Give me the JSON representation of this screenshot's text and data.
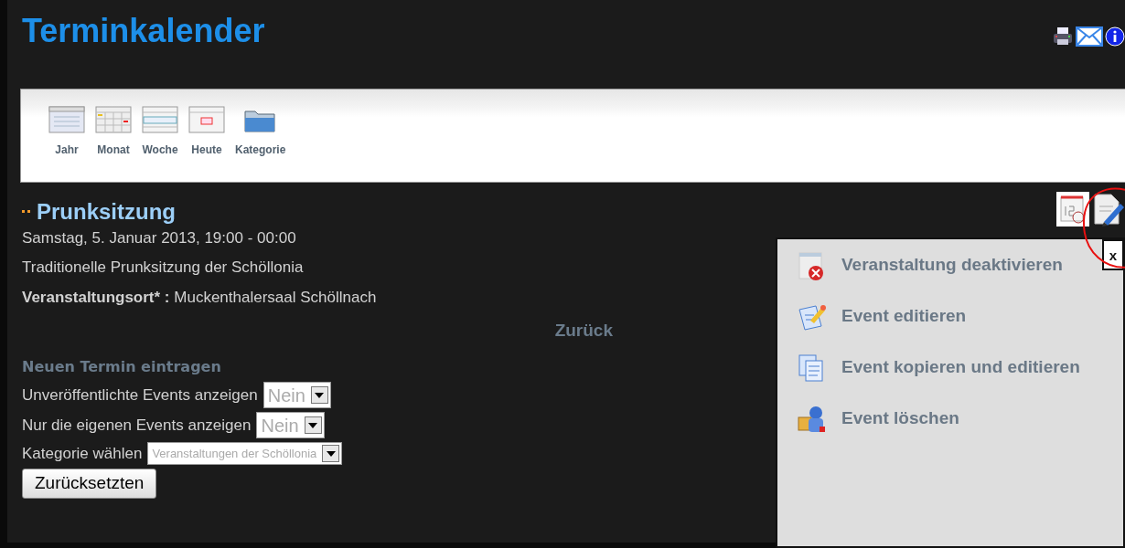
{
  "page": {
    "title": "Terminkalender"
  },
  "toolbar": {
    "items": [
      {
        "label": "Jahr"
      },
      {
        "label": "Monat"
      },
      {
        "label": "Woche"
      },
      {
        "label": "Heute"
      },
      {
        "label": "Kategorie"
      }
    ]
  },
  "event": {
    "title": "Prunksitzung",
    "date": "Samstag, 5. Januar 2013, 19:00 - 00:00",
    "description": "Traditionelle Prunksitzung der Schöllonia",
    "location_label": "Veranstaltungsort* :",
    "location": "Muckenthalersaal Schöllnach"
  },
  "back_link": "Zurück",
  "filters": {
    "heading": "Neuen Termin eintragen",
    "rows": [
      {
        "label": "Unveröffentlichte Events anzeigen",
        "value": "Nein",
        "kind": "standard"
      },
      {
        "label": "Nur die eigenen Events anzeigen",
        "value": "Nein",
        "kind": "standard"
      },
      {
        "label": "Kategorie wählen",
        "value": "Veranstaltungen der Schöllonia",
        "kind": "compact"
      }
    ],
    "reset_button": "Zurücksetzten"
  },
  "action_menu": {
    "close": "x",
    "items": [
      {
        "label": "Veranstaltung deaktivieren"
      },
      {
        "label": "Event editieren"
      },
      {
        "label": "Event kopieren und editieren"
      },
      {
        "label": "Event löschen"
      }
    ]
  }
}
